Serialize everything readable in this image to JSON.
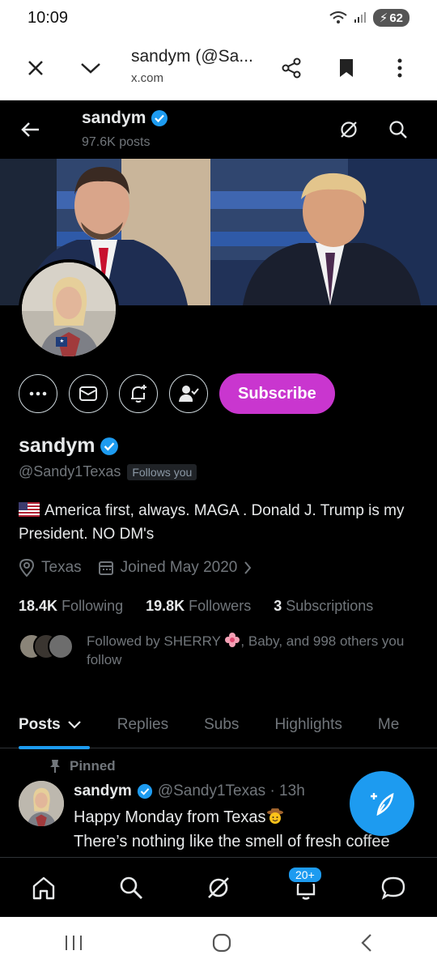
{
  "status_bar": {
    "time": "10:09",
    "battery": "62"
  },
  "browser": {
    "page_title": "sandym (@Sa...",
    "domain": "x.com"
  },
  "header": {
    "name": "sandym",
    "post_count": "97.6K posts"
  },
  "actions": {
    "subscribe_label": "Subscribe"
  },
  "profile": {
    "display_name": "sandym",
    "handle": "@Sandy1Texas",
    "follows_you": "Follows you",
    "bio": "America first, always. MAGA . Donald J. Trump is my President. NO DM's",
    "location": "Texas",
    "joined": "Joined May 2020"
  },
  "stats": {
    "following_count": "18.4K",
    "following_label": "Following",
    "followers_count": "19.8K",
    "followers_label": "Followers",
    "subscriptions_count": "3",
    "subscriptions_label": "Subscriptions"
  },
  "followed_by": {
    "prefix": "Followed by SHERRY",
    "suffix": ", Baby, and 998 others you follow"
  },
  "tabs": [
    "Posts",
    "Replies",
    "Subs",
    "Highlights",
    "Me"
  ],
  "post": {
    "pinned_label": "Pinned",
    "author": "sandym",
    "handle_time": "@Sandy1Texas · 13h",
    "line1": "Happy Monday from Texas",
    "line2": "There’s nothing like the smell of fresh coffee"
  },
  "bottom_nav": {
    "notification_badge": "20+"
  },
  "colors": {
    "accent": "#1d9bf0",
    "subscribe": "#c936cf",
    "background": "#000000"
  }
}
